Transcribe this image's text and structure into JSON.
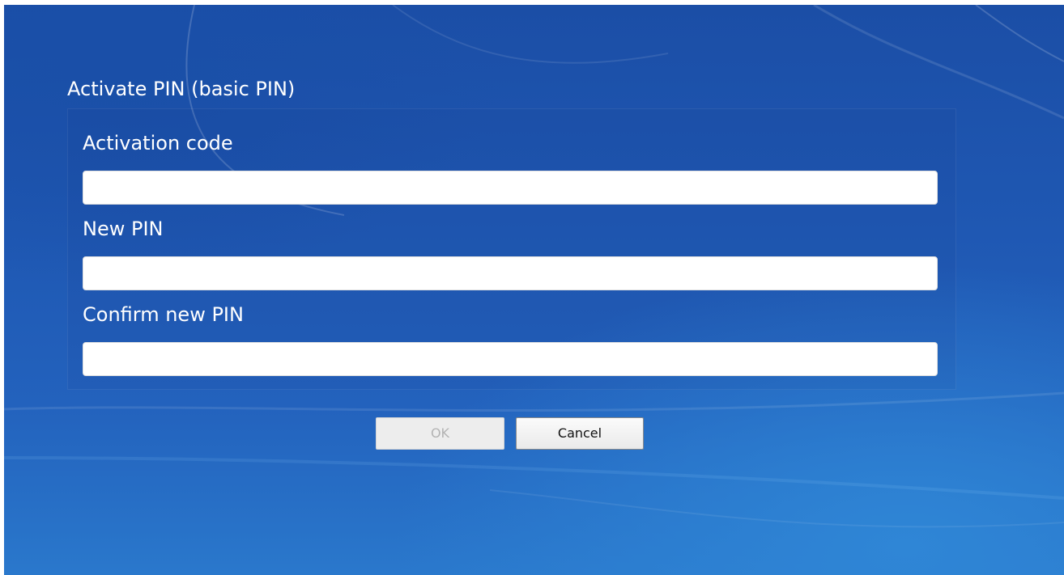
{
  "dialog": {
    "title": "Activate PIN (basic PIN)",
    "fields": [
      {
        "label": "Activation code",
        "value": ""
      },
      {
        "label": "New PIN",
        "value": ""
      },
      {
        "label": "Confirm new PIN",
        "value": ""
      }
    ],
    "buttons": {
      "ok_label": "OK",
      "ok_enabled": false,
      "cancel_label": "Cancel"
    }
  },
  "colors": {
    "background_top": "#1b4ea6",
    "background_bottom": "#2a78cc",
    "text": "#ffffff",
    "disabled_text": "#b3b3b3"
  }
}
